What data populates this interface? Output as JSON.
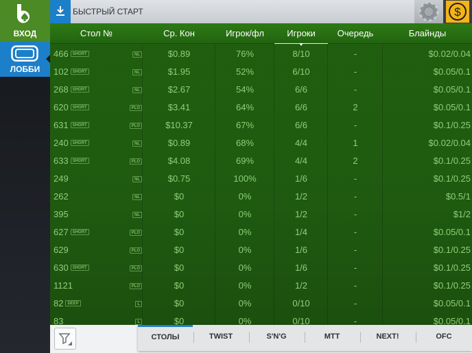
{
  "sidebar": {
    "login_label": "ВХОД",
    "lobby_label": "ЛОББИ",
    "logo_icon": "bwin-b-logo-icon",
    "lobby_icon": "lobby-screen-icon"
  },
  "topbar": {
    "quick_start_label": "БЫСТРЫЙ СТАРТ",
    "download_icon": "download-icon",
    "chip_icon": "poker-chip-icon",
    "cash_icon": "dollar-coin-icon"
  },
  "table": {
    "headers": [
      "Стол №",
      "Ср. Кон",
      "Игрок/фл",
      "Игроки",
      "Очередь",
      "Блайнды"
    ],
    "sorted_column": "Игроки",
    "rows": [
      {
        "id": "466",
        "tag": "SHORT",
        "game": "NL",
        "pot": "$0.89",
        "flop": "76%",
        "players": "8/10",
        "queue": "-",
        "blinds": "$0.02/0.04"
      },
      {
        "id": "102",
        "tag": "SHORT",
        "game": "NL",
        "pot": "$1.95",
        "flop": "52%",
        "players": "6/10",
        "queue": "-",
        "blinds": "$0.05/0.1"
      },
      {
        "id": "268",
        "tag": "SHORT",
        "game": "NL",
        "pot": "$2.67",
        "flop": "54%",
        "players": "6/6",
        "queue": "-",
        "blinds": "$0.05/0.1"
      },
      {
        "id": "620",
        "tag": "SHORT",
        "game": "PLO",
        "pot": "$3.41",
        "flop": "64%",
        "players": "6/6",
        "queue": "2",
        "blinds": "$0.05/0.1"
      },
      {
        "id": "631",
        "tag": "SHORT",
        "game": "PLO",
        "pot": "$10.37",
        "flop": "67%",
        "players": "6/6",
        "queue": "-",
        "blinds": "$0.1/0.25"
      },
      {
        "id": "240",
        "tag": "SHORT",
        "game": "NL",
        "pot": "$0.89",
        "flop": "68%",
        "players": "4/4",
        "queue": "1",
        "blinds": "$0.02/0.04"
      },
      {
        "id": "633",
        "tag": "SHORT",
        "game": "PLO",
        "pot": "$4.08",
        "flop": "69%",
        "players": "4/4",
        "queue": "2",
        "blinds": "$0.1/0.25"
      },
      {
        "id": "249",
        "tag": "",
        "game": "NL",
        "pot": "$0.75",
        "flop": "100%",
        "players": "1/6",
        "queue": "-",
        "blinds": "$0.1/0.25"
      },
      {
        "id": "262",
        "tag": "",
        "game": "NL",
        "pot": "$0",
        "flop": "0%",
        "players": "1/2",
        "queue": "-",
        "blinds": "$0.5/1"
      },
      {
        "id": "395",
        "tag": "",
        "game": "NL",
        "pot": "$0",
        "flop": "0%",
        "players": "1/2",
        "queue": "-",
        "blinds": "$1/2"
      },
      {
        "id": "627",
        "tag": "SHORT",
        "game": "PLO",
        "pot": "$0",
        "flop": "0%",
        "players": "1/4",
        "queue": "-",
        "blinds": "$0.05/0.1"
      },
      {
        "id": "629",
        "tag": "",
        "game": "PLO",
        "pot": "$0",
        "flop": "0%",
        "players": "1/6",
        "queue": "-",
        "blinds": "$0.1/0.25"
      },
      {
        "id": "630",
        "tag": "SHORT",
        "game": "PLO",
        "pot": "$0",
        "flop": "0%",
        "players": "1/6",
        "queue": "-",
        "blinds": "$0.1/0.25"
      },
      {
        "id": "1121",
        "tag": "",
        "game": "PLO",
        "pot": "$0",
        "flop": "0%",
        "players": "1/2",
        "queue": "-",
        "blinds": "$0.1/0.25"
      },
      {
        "id": "82",
        "tag": "DEEP",
        "game": "L",
        "pot": "$0",
        "flop": "0%",
        "players": "0/10",
        "queue": "-",
        "blinds": "$0.05/0.1"
      },
      {
        "id": "83",
        "tag": "",
        "game": "L",
        "pot": "$0",
        "flop": "0%",
        "players": "0/10",
        "queue": "-",
        "blinds": "$0.05/0.1"
      }
    ]
  },
  "bottombar": {
    "filter_icon": "funnel-filter-icon",
    "tabs": [
      "СТОЛЫ",
      "TWIST",
      "S'N'G",
      "MTT",
      "NEXT!",
      "OFC"
    ],
    "active_tab": "СТОЛЫ"
  }
}
